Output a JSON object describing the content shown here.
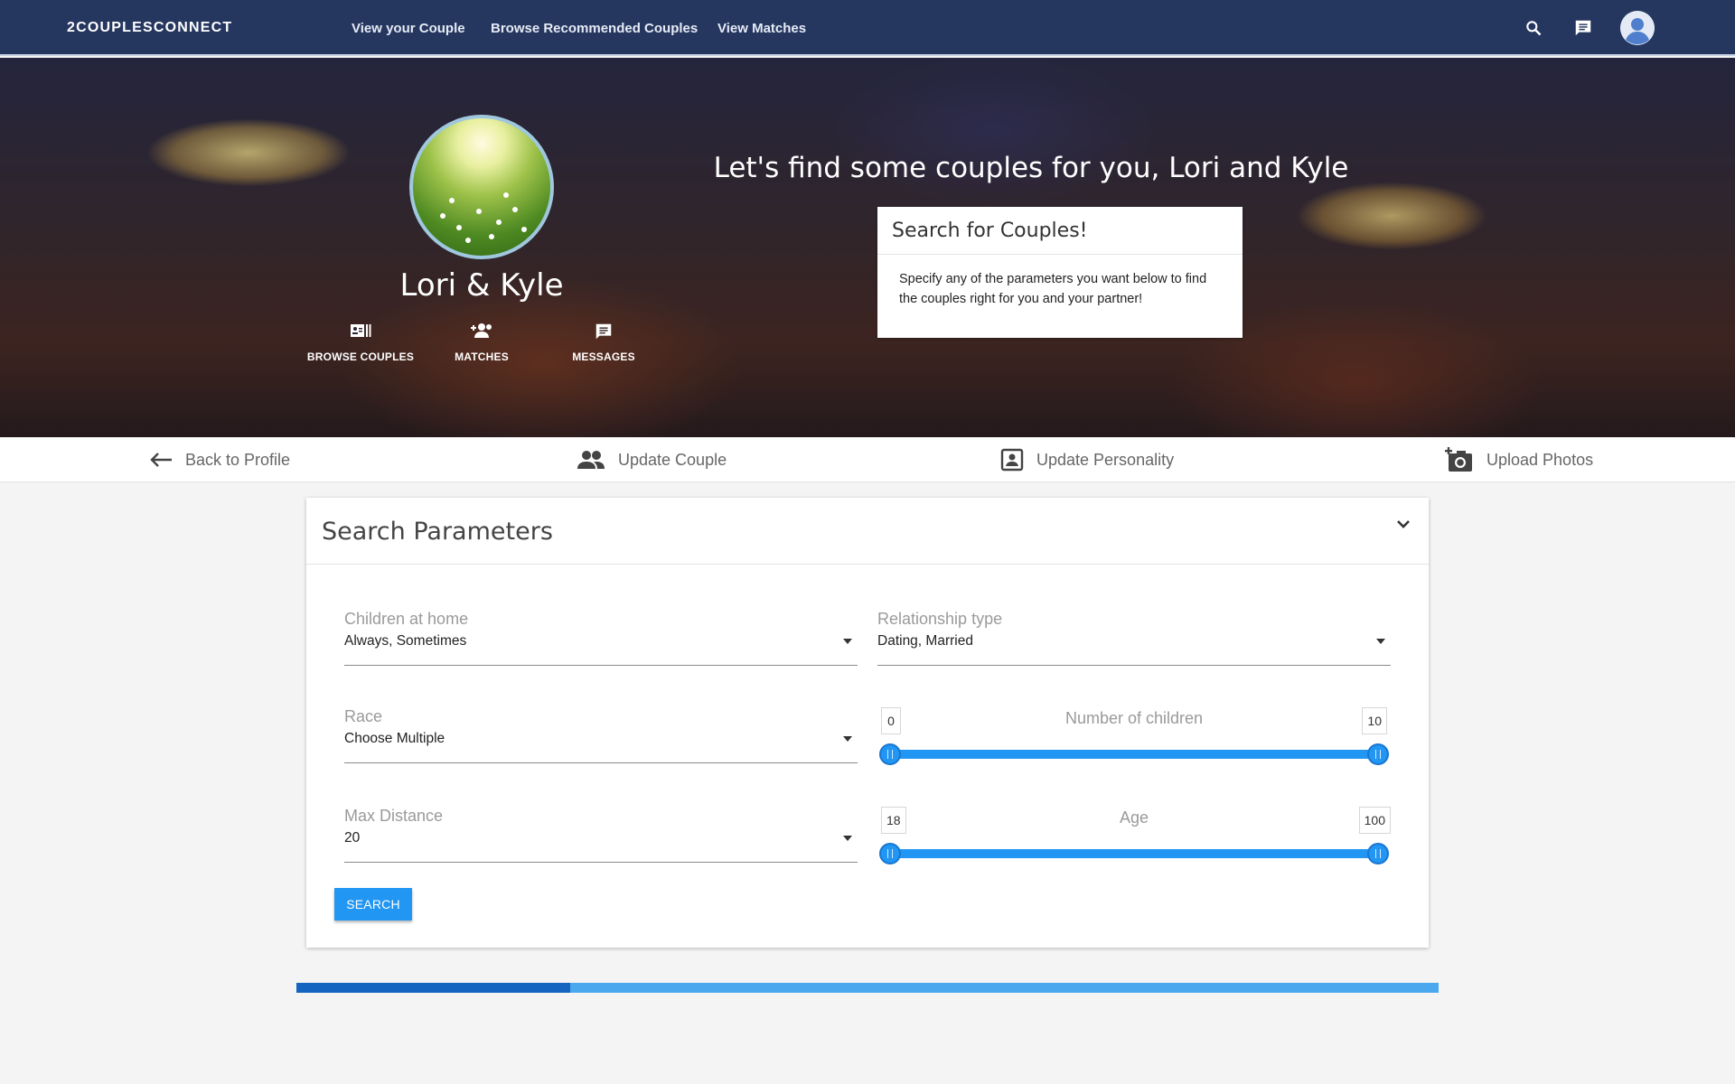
{
  "brand": "2COUPLESCONNECT",
  "nav": {
    "links": [
      "View your Couple",
      "Browse Recommended Couples",
      "View Matches"
    ],
    "icons": [
      "search-icon",
      "chat-icon",
      "account-icon"
    ]
  },
  "hero": {
    "couple_name": "Lori & Kyle",
    "actions": [
      {
        "label": "BROWSE COUPLES",
        "icon": "browse-icon"
      },
      {
        "label": "MATCHES",
        "icon": "group-add-icon"
      },
      {
        "label": "MESSAGES",
        "icon": "message-icon"
      }
    ],
    "headline": "Let's find some couples for you, Lori and Kyle",
    "card": {
      "title": "Search for Couples!",
      "body": "Specify any of the parameters you want below to find the couples right for you and your partner!"
    }
  },
  "subnav": [
    {
      "label": "Back to Profile",
      "icon": "arrow-back-icon"
    },
    {
      "label": "Update Couple",
      "icon": "people-icon"
    },
    {
      "label": "Update Personality",
      "icon": "portrait-icon"
    },
    {
      "label": "Upload Photos",
      "icon": "add-camera-icon"
    }
  ],
  "search_panel": {
    "title": "Search Parameters",
    "fields": {
      "children_at_home": {
        "label": "Children at home",
        "value": "Always, Sometimes"
      },
      "relationship_type": {
        "label": "Relationship type",
        "value": "Dating, Married"
      },
      "race": {
        "label": "Race",
        "value": "Choose Multiple"
      },
      "max_distance": {
        "label": "Max Distance",
        "value": "20"
      }
    },
    "sliders": {
      "children": {
        "label": "Number of children",
        "min": "0",
        "max": "10",
        "range_min": 0,
        "range_max": 10,
        "low": 0,
        "high": 10
      },
      "age": {
        "label": "Age",
        "min": "18",
        "max": "100",
        "range_min": 18,
        "range_max": 100,
        "low": 18,
        "high": 100
      }
    },
    "search_button": "SEARCH"
  },
  "progress": {
    "value": 0.24
  },
  "colors": {
    "nav_bg": "#25365f",
    "accent": "#2196f3",
    "accent_dark": "#1565c0"
  }
}
